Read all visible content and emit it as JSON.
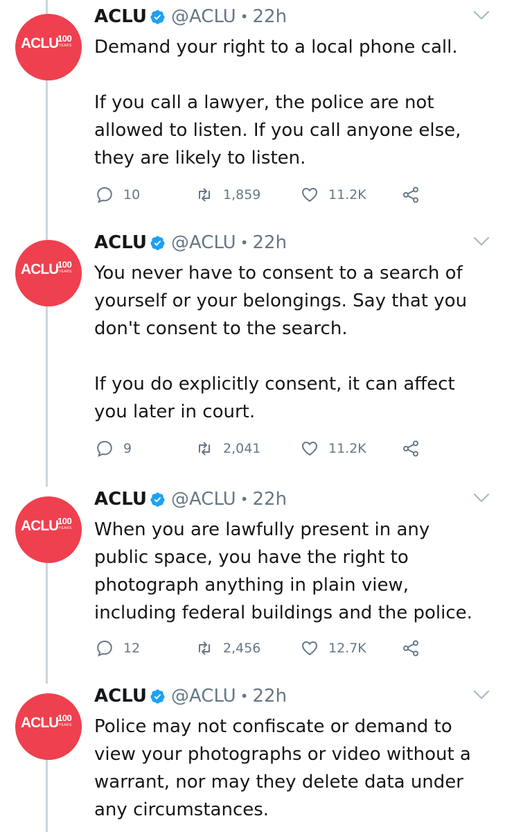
{
  "tweets": [
    {
      "author": "ACLU",
      "handle": "@ACLU",
      "separator": "•",
      "time": "22h",
      "avatar": {
        "word": "ACLU",
        "number": "100",
        "sub": "YEARS",
        "bg_color": "#ef404f"
      },
      "paragraphs": [
        "Demand your right to a local phone call.",
        "If you call a lawyer, the police are not allowed to listen. If you call anyone else, they are likely to listen."
      ],
      "replies": "10",
      "retweets": "1,859",
      "likes": "11.2K"
    },
    {
      "author": "ACLU",
      "handle": "@ACLU",
      "separator": "•",
      "time": "22h",
      "avatar": {
        "word": "ACLU",
        "number": "100",
        "sub": "YEARS",
        "bg_color": "#ef404f"
      },
      "paragraphs": [
        "You never have to consent to a search of yourself or your belongings. Say that you don't consent to the search.",
        "If you do explicitly consent, it can affect you later in court."
      ],
      "replies": "9",
      "retweets": "2,041",
      "likes": "11.2K"
    },
    {
      "author": "ACLU",
      "handle": "@ACLU",
      "separator": "•",
      "time": "22h",
      "avatar": {
        "word": "ACLU",
        "number": "100",
        "sub": "YEARS",
        "bg_color": "#ef404f"
      },
      "paragraphs": [
        "When you are lawfully present in any public space, you have the right to photograph anything in plain view, including federal buildings and the police."
      ],
      "replies": "12",
      "retweets": "2,456",
      "likes": "12.7K"
    },
    {
      "author": "ACLU",
      "handle": "@ACLU",
      "separator": "•",
      "time": "22h",
      "avatar": {
        "word": "ACLU",
        "number": "100",
        "sub": "YEARS",
        "bg_color": "#ef404f"
      },
      "paragraphs": [
        "Police may not confiscate or demand to view your photographs or video without a warrant, nor may they delete data under any circumstances."
      ]
    }
  ],
  "icons": {
    "verified": "verified-badge-icon",
    "caret": "chevron-down-icon",
    "reply": "reply-icon",
    "retweet": "retweet-icon",
    "like": "heart-icon",
    "share": "share-icon"
  },
  "colors": {
    "avatar_bg": "#ef404f",
    "verified": "#1da1f2",
    "muted": "#657786",
    "thread_line": "#ccd6dd",
    "text": "#14171a"
  }
}
